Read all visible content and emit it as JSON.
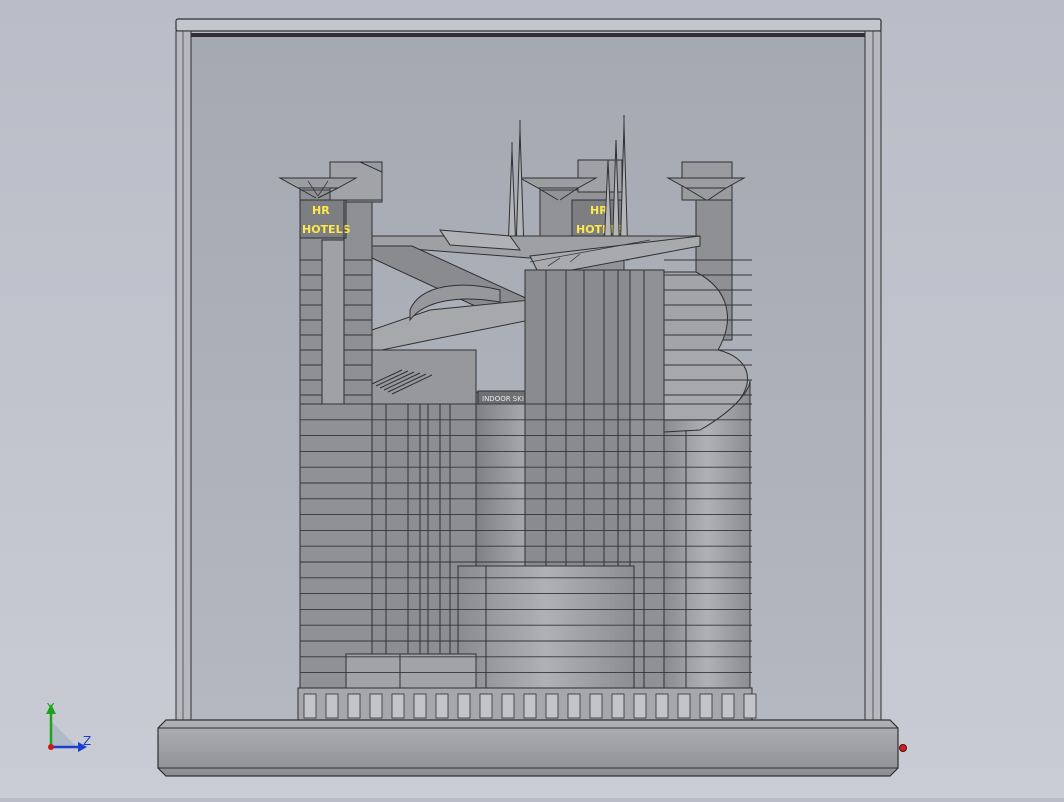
{
  "model": {
    "left_sign": {
      "line1": "HR",
      "line2": "HOTELS"
    },
    "right_sign": {
      "line1": "HR",
      "line2": "HOTELS"
    },
    "band_sign": "INDOOR SKIING HOTEL"
  },
  "triad": {
    "y_label": "Y",
    "z_label": "Z",
    "y_color": "#1fa21f",
    "z_color": "#1c3fd0",
    "origin_color": "#cc1a1a"
  },
  "colors": {
    "background_top": "#b9bdc7",
    "background_bottom": "#c9ccd4",
    "case_glass": "#a6abb5",
    "building_fill": "#8f9094",
    "base_fill": "#9a9b9e"
  }
}
